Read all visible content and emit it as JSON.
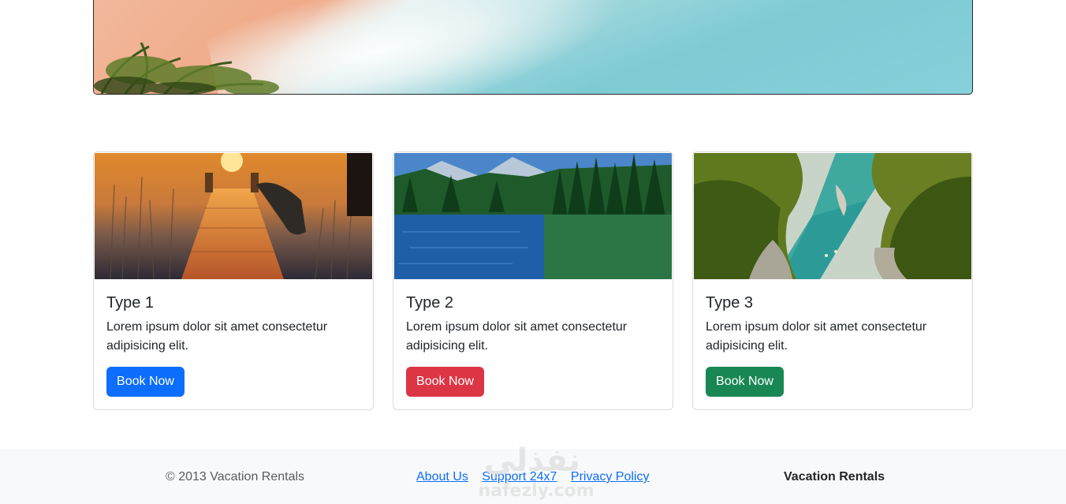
{
  "cards": [
    {
      "title": "Type 1",
      "text": "Lorem ipsum dolor sit amet consectetur adipisicing elit.",
      "button": "Book Now",
      "button_color": "#0d6efd",
      "image": "sunset-dock-lake"
    },
    {
      "title": "Type 2",
      "text": "Lorem ipsum dolor sit amet consectetur adipisicing elit.",
      "button": "Book Now",
      "button_color": "#dc3545",
      "image": "forest-lake-mountains"
    },
    {
      "title": "Type 3",
      "text": "Lorem ipsum dolor sit amet consectetur adipisicing elit.",
      "button": "Book Now",
      "button_color": "#198754",
      "image": "canyon-river-cliffs"
    }
  ],
  "footer": {
    "copyright": "© 2013 Vacation Rentals",
    "links": [
      "About Us",
      "Support 24x7",
      "Privacy Policy"
    ],
    "brand": "Vacation Rentals",
    "watermark_arabic": "نفذلي",
    "watermark_latin": "nafezly.com"
  },
  "hero": {
    "image": "beach-shoreline-palm"
  }
}
